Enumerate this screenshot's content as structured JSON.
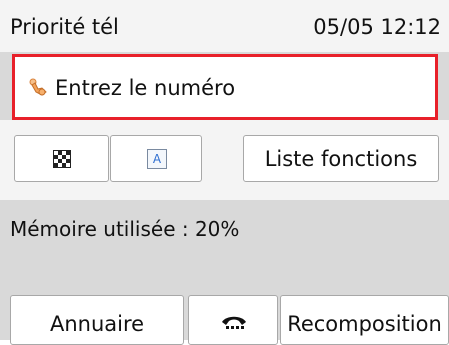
{
  "status_bar": {
    "mode_label": "Priorité tél",
    "datetime": "05/05 12:12"
  },
  "number_field": {
    "placeholder": "Entrez le numéro",
    "icon": "finger-press-icon"
  },
  "toolbar": {
    "quality_icon": "checkerboard-icon",
    "scan_icon": "document-a-icon",
    "scan_icon_letter": "A",
    "functions_label": "Liste fonctions"
  },
  "memory": {
    "label": "Mémoire utilisée : 20%",
    "percent_used": 20
  },
  "bottom_bar": {
    "directory_label": "Annuaire",
    "hook_icon": "telephone-hook-icon",
    "redial_label": "Recomposition"
  },
  "colors": {
    "field_border": "#e8202a",
    "scan_icon_letter": "#2f6fd1",
    "hand_icon": "#f0a25a"
  }
}
